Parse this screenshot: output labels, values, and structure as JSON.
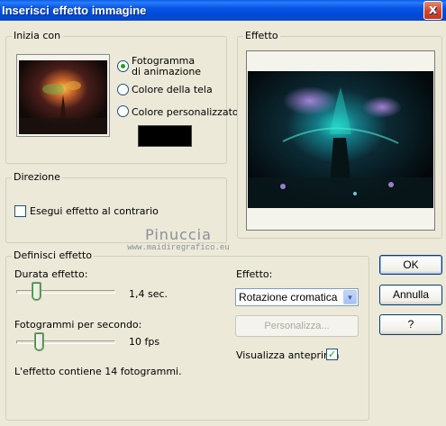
{
  "window": {
    "title": "Inserisci effetto immagine",
    "close_glyph": "x"
  },
  "start_group": {
    "label": "Inizia con",
    "radio_options": [
      "Fotogramma\ndi animazione",
      "Colore della tela",
      "Colore personalizzato"
    ],
    "selected_index": 0,
    "custom_color": "#000000"
  },
  "effect_preview": {
    "label": "Effetto"
  },
  "direction_group": {
    "label": "Direzione",
    "reverse_label": "Esegui effetto al contrario",
    "reverse_checked": false
  },
  "watermark": {
    "line1": "Pinuccia",
    "line2": "www.maidiregrafico.eu"
  },
  "define_group": {
    "label": "Definisci effetto",
    "duration_label": "Durata effetto:",
    "duration_value": "1,4 sec.",
    "duration_level": 0.17,
    "fps_label": "Fotogrammi per secondo:",
    "fps_value": "10 fps",
    "fps_level": 0.2,
    "info_text": "L'effetto contiene 14 fotogrammi.",
    "effect_label": "Effetto:",
    "effect_selected": "Rotazione cromatica",
    "customize_label": "Personalizza...",
    "preview_label": "Visualizza anteprima",
    "preview_checked": true
  },
  "buttons": {
    "ok": "OK",
    "cancel": "Annulla",
    "help": "?"
  },
  "colors": {
    "title_bar": "#0054e3",
    "dialog_bg": "#ece9d8",
    "radio_dot": "#21a121"
  }
}
